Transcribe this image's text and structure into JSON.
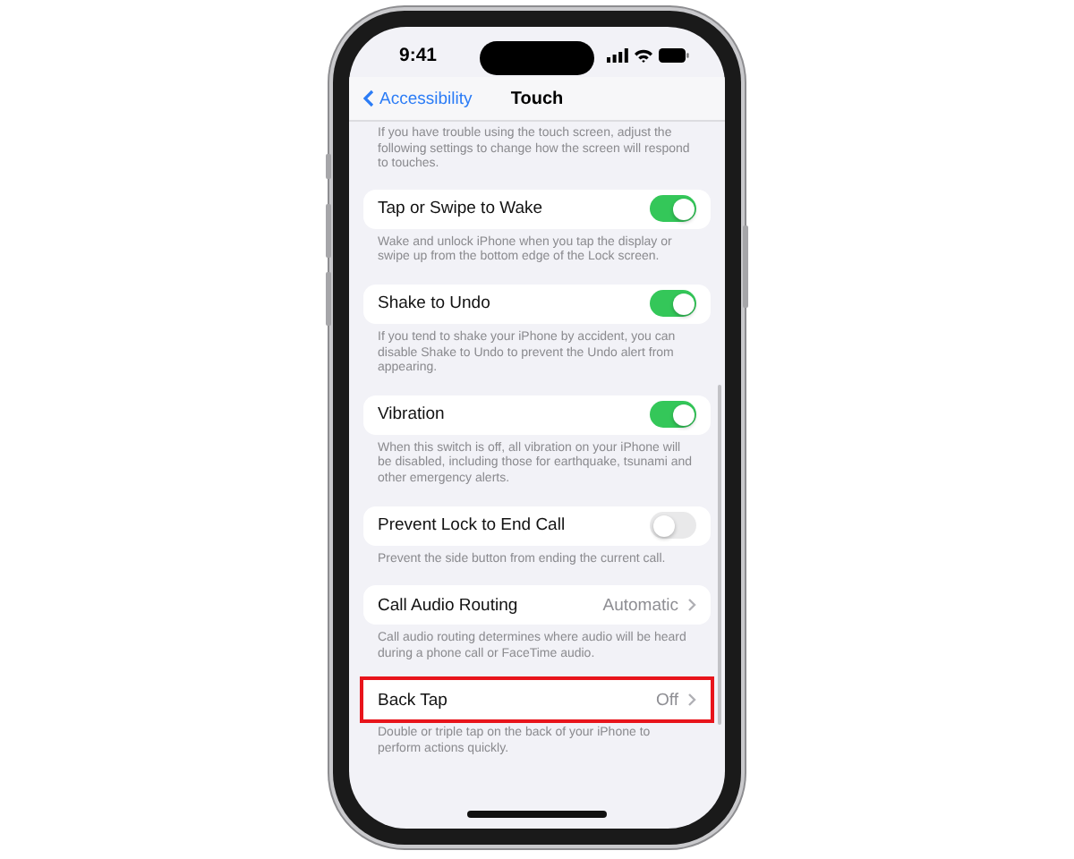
{
  "status_bar": {
    "time": "9:41"
  },
  "nav": {
    "back": "Accessibility",
    "title": "Touch"
  },
  "intro": "If you have trouble using the touch screen, adjust the following settings to change how the screen will respond to touches.",
  "groups": [
    {
      "kind": "toggle",
      "label": "Tap or Swipe to Wake",
      "on": true,
      "highlighted": false,
      "note": "Wake and unlock iPhone when you tap the display or swipe up from the bottom edge of the Lock screen."
    },
    {
      "kind": "toggle",
      "label": "Shake to Undo",
      "on": true,
      "highlighted": false,
      "note": "If you tend to shake your iPhone by accident, you can disable Shake to Undo to prevent the Undo alert from appearing."
    },
    {
      "kind": "toggle",
      "label": "Vibration",
      "on": true,
      "highlighted": false,
      "note": "When this switch is off, all vibration on your iPhone will be disabled, including those for earthquake, tsunami and other emergency alerts."
    },
    {
      "kind": "toggle",
      "label": "Prevent Lock to End Call",
      "on": false,
      "highlighted": false,
      "note": "Prevent the side button from ending the current call."
    },
    {
      "kind": "link",
      "label": "Call Audio Routing",
      "value": "Automatic",
      "highlighted": false,
      "note": "Call audio routing determines where audio will be heard during a phone call or FaceTime audio."
    },
    {
      "kind": "link",
      "label": "Back Tap",
      "value": "Off",
      "highlighted": true,
      "note": "Double or triple tap on the back of your iPhone to perform actions quickly."
    }
  ]
}
